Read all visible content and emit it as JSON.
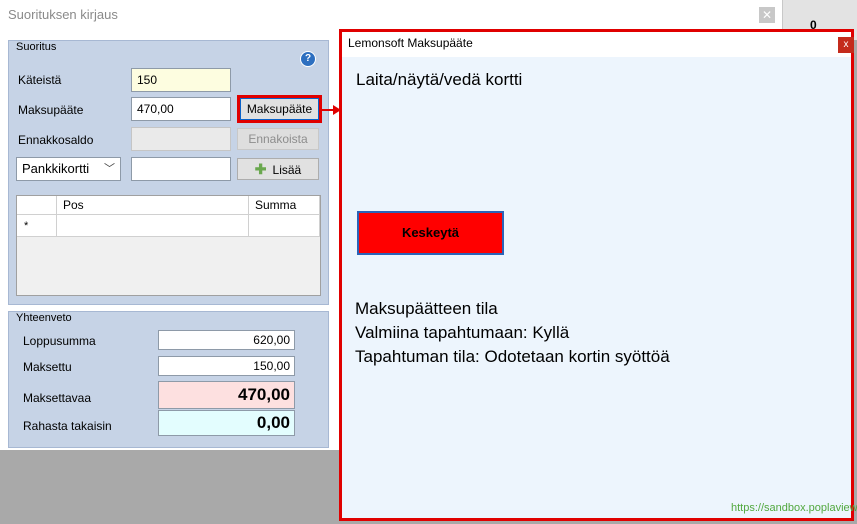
{
  "main_window": {
    "title": "Suorituksen kirjaus",
    "right_stub_text": "0"
  },
  "suoritus": {
    "title": "Suoritus",
    "kateista_label": "Käteistä",
    "kateista_value": "150",
    "maksupaate_label": "Maksupääte",
    "maksupaate_value": "470,00",
    "maksupaate_button": "Maksupääte",
    "ennakkosaldo_label": "Ennakkosaldo",
    "ennakkosaldo_value": "",
    "ennakoista_button": "Ennakoista",
    "payment_type_selected": "Pankkikortti",
    "payment_amount_value": "",
    "add_button": "Lisää",
    "grid": {
      "columns": [
        "",
        "Pos",
        "Summa"
      ],
      "new_row_marker": "*"
    }
  },
  "yhteenveto": {
    "title": "Yhteenveto",
    "loppusumma_label": "Loppusumma",
    "loppusumma_value": "620,00",
    "maksettu_label": "Maksettu",
    "maksettu_value": "150,00",
    "maksettavaa_label": "Maksettavaa",
    "maksettavaa_value": "470,00",
    "rahasta_label": "Rahasta takaisin",
    "rahasta_value": "0,00"
  },
  "terminal": {
    "title": "Lemonsoft Maksupääte",
    "close_glyph": "x",
    "instruction": "Laita/näytä/vedä kortti",
    "cancel_button": "Keskeytä",
    "status_heading": "Maksupäätteen tila",
    "ready_line": "Valmiina tapahtumaan: Kyllä",
    "state_line": "Tapahtuman tila: Odotetaan kortin syöttöä",
    "footer_link": "https://sandbox.poplaview"
  },
  "colors": {
    "highlight_red": "#e00000",
    "cancel_red": "#ff0000",
    "panel_blue": "#c6d3e6",
    "due_pink": "#fde0e0",
    "change_cyan": "#e3fdfe"
  }
}
